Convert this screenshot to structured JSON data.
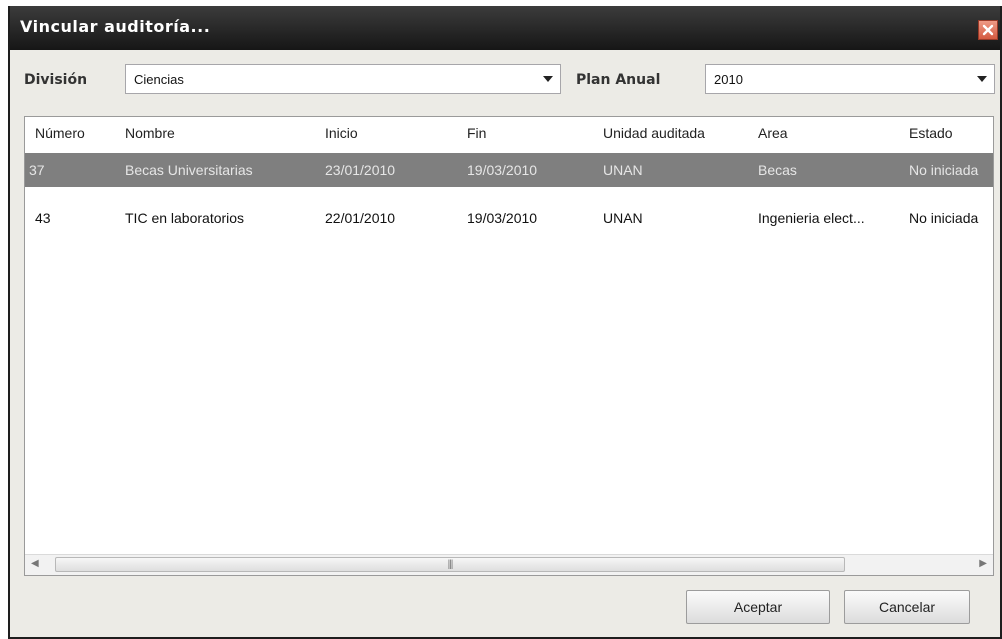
{
  "window": {
    "title": "Vincular auditoría..."
  },
  "filters": {
    "division_label": "División",
    "division_value": "Ciencias",
    "plan_label": "Plan Anual",
    "plan_value": "2010"
  },
  "table": {
    "columns": [
      "Número",
      "Nombre",
      "Inicio",
      "Fin",
      "Unidad auditada",
      "Area",
      "Estado"
    ],
    "rows": [
      [
        "37",
        "Becas Universitarias",
        "23/01/2010",
        "19/03/2010",
        "UNAN",
        "Becas",
        "No iniciada"
      ],
      [
        "43",
        "TIC en laboratorios",
        "22/01/2010",
        "19/03/2010",
        "UNAN",
        "Ingenieria elect...",
        "No iniciada"
      ]
    ],
    "selected_row": 0
  },
  "buttons": {
    "accept": "Aceptar",
    "cancel": "Cancelar"
  },
  "colors": {
    "selection": "#7f7f7f",
    "titlebar": "#1e1e1e",
    "close": "#d45a40"
  }
}
